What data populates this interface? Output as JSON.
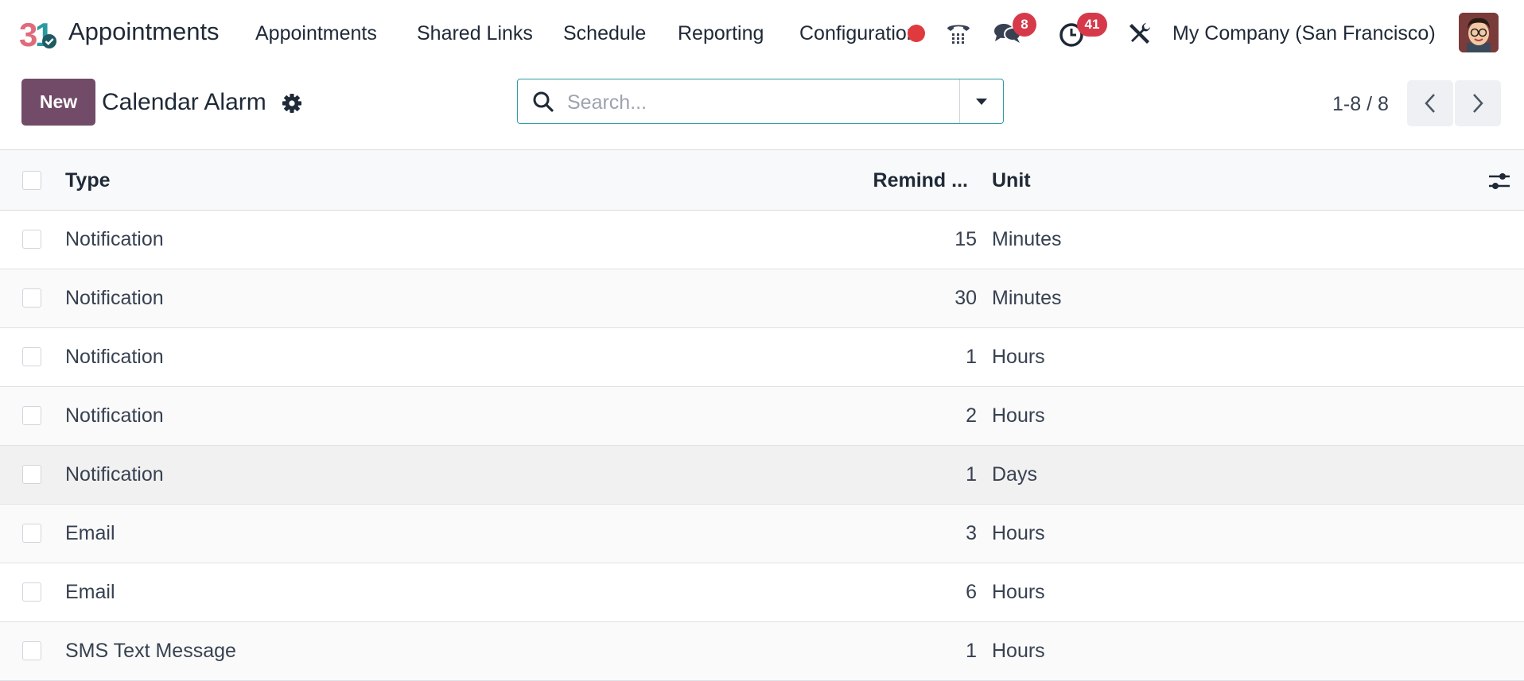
{
  "navbar": {
    "app_name": "Appointments",
    "menu": [
      "Appointments",
      "Shared Links",
      "Schedule",
      "Reporting",
      "Configuration"
    ],
    "messages_count": "8",
    "activities_count": "41",
    "company": "My Company (San Francisco)",
    "icons": [
      "phone-icon",
      "chat-icon",
      "clock-icon",
      "tools-icon"
    ],
    "accent_color": "#714b67",
    "badge_color": "#d63a4a"
  },
  "control_panel": {
    "new_label": "New",
    "breadcrumb": "Calendar Alarm",
    "search_placeholder": "Search...",
    "pager": "1-8 / 8"
  },
  "table": {
    "headers": {
      "type": "Type",
      "remind": "Remind ...",
      "unit": "Unit"
    },
    "rows": [
      {
        "type": "Notification",
        "remind": "15",
        "unit": "Minutes"
      },
      {
        "type": "Notification",
        "remind": "30",
        "unit": "Minutes"
      },
      {
        "type": "Notification",
        "remind": "1",
        "unit": "Hours"
      },
      {
        "type": "Notification",
        "remind": "2",
        "unit": "Hours"
      },
      {
        "type": "Notification",
        "remind": "1",
        "unit": "Days"
      },
      {
        "type": "Email",
        "remind": "3",
        "unit": "Hours"
      },
      {
        "type": "Email",
        "remind": "6",
        "unit": "Hours"
      },
      {
        "type": "SMS Text Message",
        "remind": "1",
        "unit": "Hours"
      }
    ]
  }
}
